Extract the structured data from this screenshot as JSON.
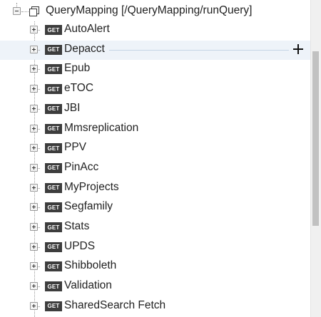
{
  "tree": {
    "root": {
      "label": "QueryMapping [/QueryMapping/runQuery]",
      "icon": "folder-pages-icon"
    },
    "method_badge": "GET",
    "items": [
      {
        "label": "AutoAlert"
      },
      {
        "label": "Depacct"
      },
      {
        "label": "Epub"
      },
      {
        "label": "eTOC"
      },
      {
        "label": "JBI"
      },
      {
        "label": "Mmsreplication"
      },
      {
        "label": "PPV"
      },
      {
        "label": "PinAcc"
      },
      {
        "label": "MyProjects"
      },
      {
        "label": "Segfamily"
      },
      {
        "label": "Stats"
      },
      {
        "label": "UPDS"
      },
      {
        "label": "Shibboleth"
      },
      {
        "label": "Validation"
      },
      {
        "label": "SharedSearch Fetch"
      }
    ],
    "hover_action_icon": "plus-icon"
  },
  "colors": {
    "hover_bg": "#eef3f9",
    "badge_bg": "#3d3d3d",
    "scroll_thumb": "#c1c1c1"
  }
}
